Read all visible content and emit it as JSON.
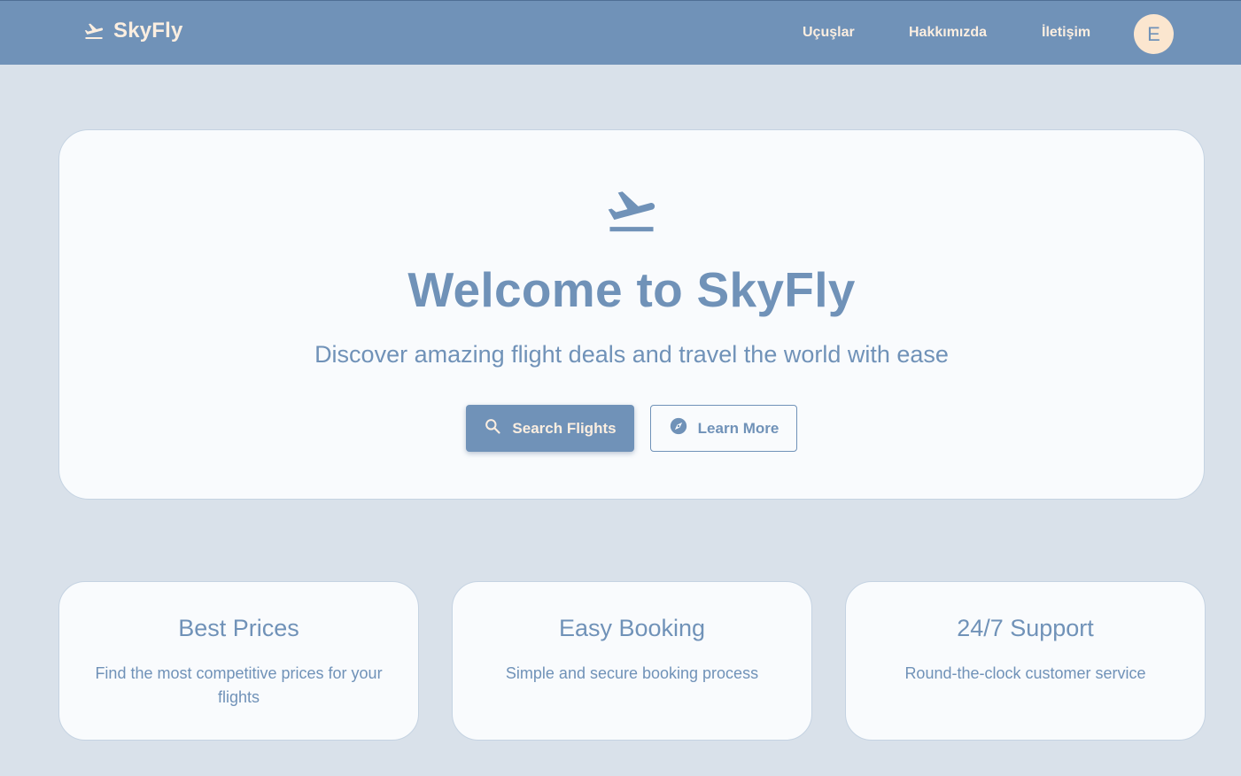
{
  "header": {
    "brand": "SkyFly",
    "brand_icon": "flight-takeoff-icon",
    "nav": [
      "Uçuşlar",
      "Hakkımızda",
      "İletişim"
    ],
    "avatar_initial": "E"
  },
  "hero": {
    "icon": "flight-takeoff-icon",
    "title": "Welcome to SkyFly",
    "subtitle": "Discover amazing flight deals and travel the world with ease",
    "primary_button": {
      "label": "Search Flights",
      "icon": "search-icon"
    },
    "secondary_button": {
      "label": "Learn More",
      "icon": "compass-icon"
    }
  },
  "features": [
    {
      "title": "Best Prices",
      "description": "Find the most competitive prices for your flights"
    },
    {
      "title": "Easy Booking",
      "description": "Simple and secure booking process"
    },
    {
      "title": "24/7 Support",
      "description": "Round-the-clock customer service"
    }
  ],
  "colors": {
    "primary": "#7092b8",
    "background": "#d9e1ea",
    "card": "#f9fbfd",
    "accent_light": "#fbeee0"
  }
}
